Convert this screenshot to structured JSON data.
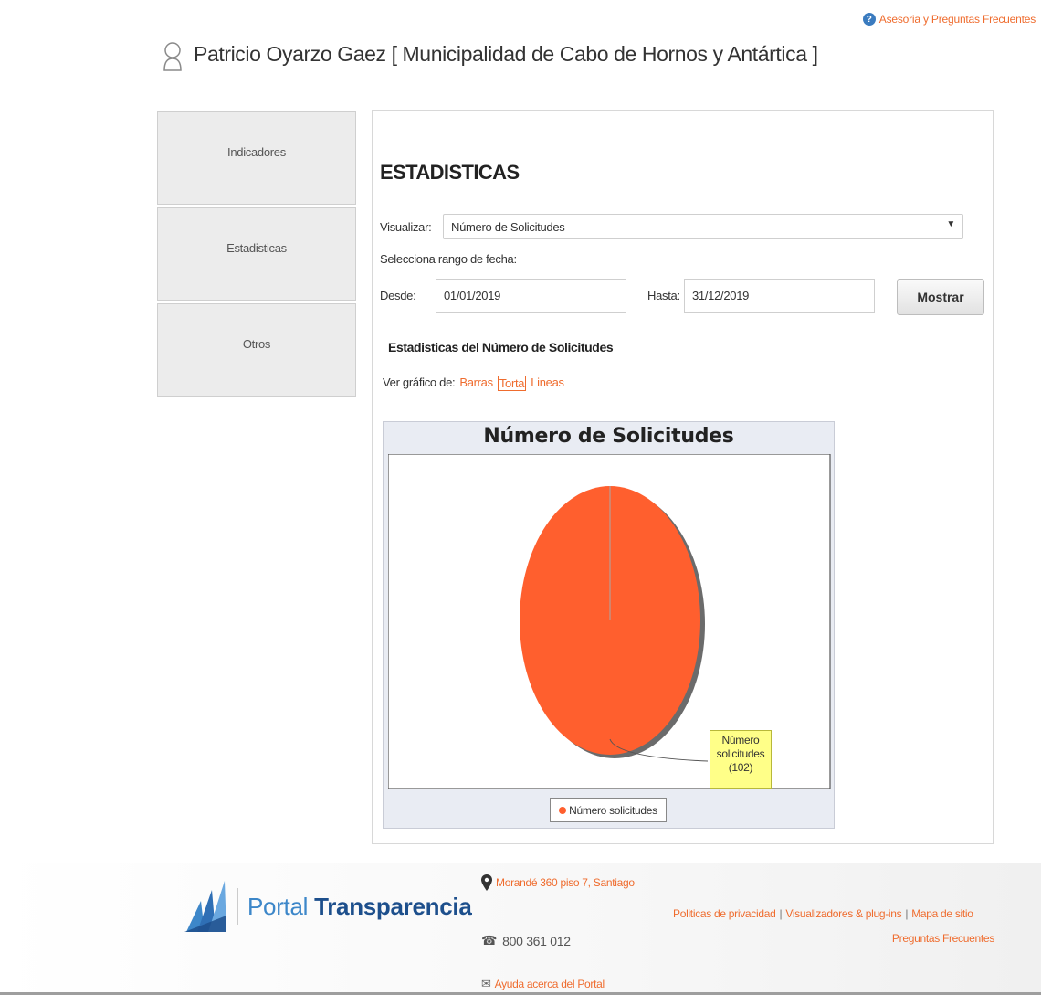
{
  "top_bar": {
    "help_link": "Asesoria y Preguntas Frecuentes"
  },
  "header": {
    "user_title": "Patricio Oyarzo Gaez [ Municipalidad de Cabo de Hornos y Antártica ]"
  },
  "sidebar": {
    "items": [
      {
        "label": "Indicadores"
      },
      {
        "label": "Estadisticas"
      },
      {
        "label": "Otros"
      }
    ]
  },
  "main": {
    "title": "ESTADISTICAS",
    "visualizar_label": "Visualizar:",
    "visualizar_value": "Número de Solicitudes",
    "rango_label": "Selecciona rango de fecha:",
    "desde_label": "Desde:",
    "desde_value": "01/01/2019",
    "hasta_label": "Hasta:",
    "hasta_value": "31/12/2019",
    "mostrar_button": "Mostrar",
    "subtitle": "Estadisticas del Número de Solicitudes",
    "ver_grafico_label": "Ver gráfico de:",
    "chart_types": [
      {
        "label": "Barras",
        "active": false
      },
      {
        "label": "Torta",
        "active": true
      },
      {
        "label": "Lineas",
        "active": false
      }
    ]
  },
  "chart_data": {
    "type": "pie",
    "title": "Número de Solicitudes",
    "slices": [
      {
        "label": "Número solicitudes",
        "value": 102,
        "color": "#ff5f2e"
      }
    ],
    "data_label": [
      "Número",
      "solicitudes",
      "(102)"
    ],
    "legend": [
      "Número solicitudes"
    ],
    "legend_position": "bottom"
  },
  "footer": {
    "logo_text_light": "Portal",
    "logo_text_bold": "Transparencia",
    "address": "Morandé 360 piso 7, Santiago",
    "phone": "800 361 012",
    "help": "Ayuda acerca del Portal",
    "links": [
      "Politicas de privacidad",
      "Visualizadores & plug-ins",
      "Mapa de sitio"
    ],
    "links_row2": "Preguntas Frecuentes"
  },
  "colors": {
    "accent": "#ef6c2e",
    "pie": "#ff5f2e",
    "brand_blue": "#3d87c9"
  }
}
